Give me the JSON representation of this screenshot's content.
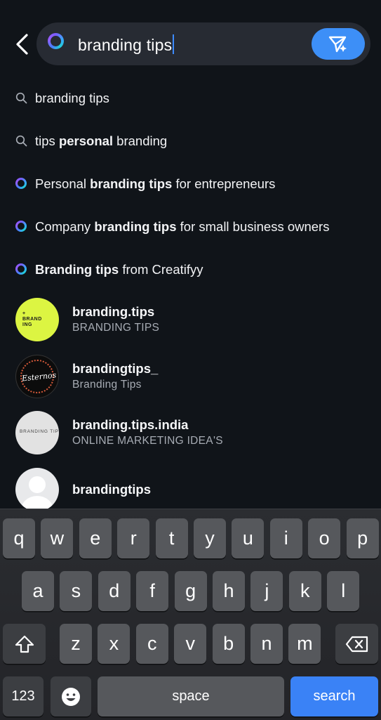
{
  "search": {
    "query": "branding tips"
  },
  "suggestions": [
    {
      "type": "search",
      "parts": [
        {
          "t": "branding tips",
          "b": false
        }
      ]
    },
    {
      "type": "search",
      "parts": [
        {
          "t": "tips ",
          "b": false
        },
        {
          "t": "personal",
          "b": true
        },
        {
          "t": " branding",
          "b": false
        }
      ]
    },
    {
      "type": "ai",
      "parts": [
        {
          "t": "Personal ",
          "b": false
        },
        {
          "t": "branding tips",
          "b": true
        },
        {
          "t": " for entrepreneurs",
          "b": false
        }
      ]
    },
    {
      "type": "ai",
      "parts": [
        {
          "t": "Company ",
          "b": false
        },
        {
          "t": "branding tips",
          "b": true
        },
        {
          "t": " for small business owners",
          "b": false
        }
      ]
    },
    {
      "type": "ai",
      "parts": [
        {
          "t": "Branding tips",
          "b": true
        },
        {
          "t": " from Creatifyy",
          "b": false
        }
      ]
    }
  ],
  "accounts": [
    {
      "username": "branding.tips",
      "subtitle": "BRANDING TIPS",
      "avatar_text": "+\nBRAND\nING"
    },
    {
      "username": "brandingtips_",
      "subtitle": "Branding Tips",
      "avatar_text": "Esternos"
    },
    {
      "username": "branding.tips.india",
      "subtitle": "ONLINE MARKETING IDEA'S",
      "avatar_text": "BRANDING TIPS"
    },
    {
      "username": "brandingtips",
      "subtitle": "",
      "avatar_text": ""
    }
  ],
  "keyboard": {
    "row1": [
      "q",
      "w",
      "e",
      "r",
      "t",
      "y",
      "u",
      "i",
      "o",
      "p"
    ],
    "row2": [
      "a",
      "s",
      "d",
      "f",
      "g",
      "h",
      "j",
      "k",
      "l"
    ],
    "row3": [
      "z",
      "x",
      "c",
      "v",
      "b",
      "n",
      "m"
    ],
    "numbers_label": "123",
    "space_label": "space",
    "search_label": "search"
  }
}
